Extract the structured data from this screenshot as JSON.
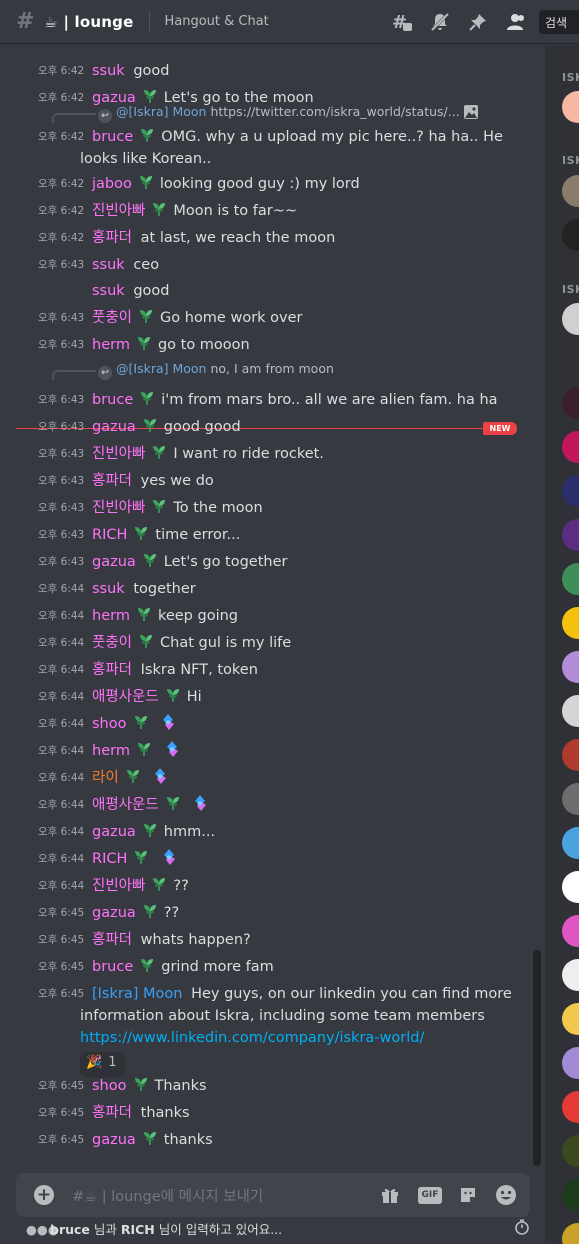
{
  "header": {
    "channel_prefix_emoji": "☕",
    "channel_name": "| lounge",
    "topic": "Hangout & Chat",
    "search_placeholder": "검색"
  },
  "messages": [
    {
      "ts": "오후 6:42",
      "author": "ssuk",
      "color": "#ff73fa",
      "badge": false,
      "text": "good"
    },
    {
      "ts": "오후 6:42",
      "author": "gazua",
      "color": "#ff73fa",
      "badge": true,
      "text": "Let's go to the moon"
    },
    {
      "ts": "오후 6:42",
      "author": "bruce",
      "color": "#ff73fa",
      "badge": true,
      "text": "OMG. why a u upload my pic here..?  ha ha.. He",
      "text2": "looks like Korean..",
      "reply_name": "@[Iskra] Moon",
      "reply_text": "https://twitter.com/iskra_world/status/..."
    },
    {
      "ts": "오후 6:42",
      "author": "jaboo",
      "color": "#ff73fa",
      "badge": true,
      "text": "looking good guy :) my lord"
    },
    {
      "ts": "오후 6:42",
      "author": "진빈아빠",
      "color": "#ff73fa",
      "badge": true,
      "text": "Moon is to far~~"
    },
    {
      "ts": "오후 6:42",
      "author": "홍파더",
      "color": "#ff73fa",
      "badge": false,
      "text": "at last, we reach the moon"
    },
    {
      "ts": "오후 6:43",
      "author": "ssuk",
      "color": "#ff73fa",
      "badge": false,
      "text": "ceo"
    },
    {
      "ts": "",
      "author": "ssuk",
      "color": "#ff73fa",
      "badge": false,
      "text": "good"
    },
    {
      "ts": "오후 6:43",
      "author": "풋충이",
      "color": "#ff73fa",
      "badge": true,
      "text": "Go home work over"
    },
    {
      "ts": "오후 6:43",
      "author": "herm",
      "color": "#ff73fa",
      "badge": true,
      "text": "go to mooon"
    },
    {
      "ts": "오후 6:43",
      "author": "bruce",
      "color": "#ff73fa",
      "badge": true,
      "text": "i'm from mars bro..   all we are alien fam. ha ha",
      "reply_name": "@[Iskra] Moon",
      "reply_text": "no, I am from moon"
    },
    {
      "ts": "오후 6:43",
      "author": "gazua",
      "color": "#ff73fa",
      "badge": true,
      "text": "good good"
    },
    {
      "ts": "오후 6:43",
      "author": "진빈아빠",
      "color": "#ff73fa",
      "badge": true,
      "text": "I want ro ride rocket."
    },
    {
      "ts": "오후 6:43",
      "author": "홍파더",
      "color": "#ff73fa",
      "badge": false,
      "text": "yes we do"
    },
    {
      "ts": "오후 6:43",
      "author": "진빈아빠",
      "color": "#ff73fa",
      "badge": true,
      "text": "To the moon"
    },
    {
      "ts": "오후 6:43",
      "author": "RICH",
      "color": "#ff73fa",
      "badge": true,
      "text": "time error..."
    },
    {
      "ts": "오후 6:43",
      "author": "gazua",
      "color": "#ff73fa",
      "badge": true,
      "text": "Let's go together"
    },
    {
      "ts": "오후 6:44",
      "author": "ssuk",
      "color": "#ff73fa",
      "badge": false,
      "text": "together"
    },
    {
      "ts": "오후 6:44",
      "author": "herm",
      "color": "#ff73fa",
      "badge": true,
      "text": "keep going"
    },
    {
      "ts": "오후 6:44",
      "author": "풋충이",
      "color": "#ff73fa",
      "badge": true,
      "text": "Chat gul is my life"
    },
    {
      "ts": "오후 6:44",
      "author": "홍파더",
      "color": "#ff73fa",
      "badge": false,
      "text": "Iskra NFT, token"
    },
    {
      "ts": "오후 6:44",
      "author": "애평사운드",
      "color": "#ff73fa",
      "badge": true,
      "text": "Hi"
    },
    {
      "ts": "오후 6:44",
      "author": "shoo",
      "color": "#ff73fa",
      "badge": true,
      "text": "",
      "spark": true
    },
    {
      "ts": "오후 6:44",
      "author": "herm",
      "color": "#ff73fa",
      "badge": true,
      "text": "",
      "spark": true
    },
    {
      "ts": "오후 6:44",
      "author": "라이",
      "color": "#f47b31",
      "badge": true,
      "text": "",
      "spark": true
    },
    {
      "ts": "오후 6:44",
      "author": "애평사운드",
      "color": "#ff73fa",
      "badge": true,
      "text": "",
      "spark": true
    },
    {
      "ts": "오후 6:44",
      "author": "gazua",
      "color": "#ff73fa",
      "badge": true,
      "text": "hmm..."
    },
    {
      "ts": "오후 6:44",
      "author": "RICH",
      "color": "#ff73fa",
      "badge": true,
      "text": "",
      "spark": true
    },
    {
      "ts": "오후 6:44",
      "author": "진빈아빠",
      "color": "#ff73fa",
      "badge": true,
      "text": "??"
    },
    {
      "ts": "오후 6:45",
      "author": "gazua",
      "color": "#ff73fa",
      "badge": true,
      "text": "??"
    },
    {
      "ts": "오후 6:45",
      "author": "홍파더",
      "color": "#ff73fa",
      "badge": false,
      "text": "whats happen?"
    },
    {
      "ts": "오후 6:45",
      "author": "bruce",
      "color": "#ff73fa",
      "badge": true,
      "text": "grind more fam"
    },
    {
      "ts": "오후 6:45",
      "author": "[Iskra] Moon",
      "color": "#3a9ff5",
      "badge": false,
      "text": "Hey guys, on our linkedin you can find more",
      "text2": "information about Iskra, including some team members",
      "link": "https://www.linkedin.com/company/iskra-world/",
      "reaction_emoji": "🎉",
      "reaction_count": "1"
    },
    {
      "ts": "오후 6:45",
      "author": "shoo",
      "color": "#ff73fa",
      "badge": true,
      "text": "Thanks"
    },
    {
      "ts": "오후 6:45",
      "author": "홍파더",
      "color": "#ff73fa",
      "badge": false,
      "text": "thanks"
    },
    {
      "ts": "오후 6:45",
      "author": "gazua",
      "color": "#ff73fa",
      "badge": true,
      "text": "thanks"
    }
  ],
  "new_marker": "NEW",
  "members": {
    "headers": [
      "ISK",
      "ISK",
      "ISK"
    ],
    "avatar_colors": [
      "#f7b7a3",
      "#8a7c6a",
      "#222222",
      "#d0d0d0",
      "#3b1f2b",
      "#c2185b",
      "#2a2f6b",
      "#5a2d82",
      "#3e8e5a",
      "#f4c20d",
      "#b38cd9",
      "#d5d5d5",
      "#b03a2e",
      "#6d6d6d",
      "#4aa3df",
      "#ffffff",
      "#e055c1",
      "#eeeeee",
      "#f2c94c",
      "#a28bd4",
      "#e53935",
      "#3a4a1e",
      "#1d3b1d",
      "#c9a227"
    ]
  },
  "composer": {
    "placeholder_prefix": "#☕ | lounge",
    "placeholder_suffix": "에 메시지 보내기",
    "gif_label": "GIF"
  },
  "typing": {
    "user1": "bruce",
    "mid": " 님과 ",
    "user2": "RICH",
    "suffix": " 님이 입력하고 있어요..."
  }
}
